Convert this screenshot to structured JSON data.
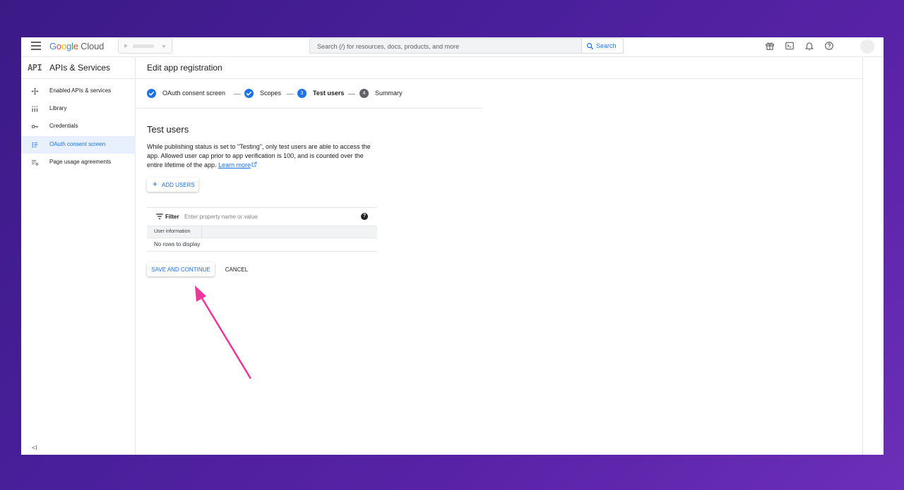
{
  "topbar": {
    "logo_text": "Google Cloud",
    "search_placeholder": "Search (/) for resources, docs, products, and more",
    "search_button": "Search"
  },
  "sidebar": {
    "badge": "API",
    "title": "APIs & Services",
    "items": [
      {
        "label": "Enabled APIs & services",
        "icon": "diamond-dots-icon",
        "active": false
      },
      {
        "label": "Library",
        "icon": "library-grid-icon",
        "active": false
      },
      {
        "label": "Credentials",
        "icon": "key-icon",
        "active": false
      },
      {
        "label": "OAuth consent screen",
        "icon": "consent-dots-icon",
        "active": true
      },
      {
        "label": "Page usage agreements",
        "icon": "settings-list-icon",
        "active": false
      }
    ],
    "collapse_glyph": "<I"
  },
  "main": {
    "title": "Edit app registration",
    "steps": [
      {
        "label": "OAuth consent screen",
        "state": "done"
      },
      {
        "label": "Scopes",
        "state": "done"
      },
      {
        "label": "Test users",
        "state": "current",
        "number": "3"
      },
      {
        "label": "Summary",
        "state": "pending",
        "number": "4"
      }
    ],
    "section_title": "Test users",
    "description": "While publishing status is set to \"Testing\", only test users are able to access the app. Allowed user cap prior to app verification is 100, and is counted over the entire lifetime of the app.",
    "learn_more": "Learn more",
    "add_users": "ADD USERS",
    "filter_label": "Filter",
    "filter_placeholder": "Enter property name or value",
    "table_column": "User information",
    "no_rows": "No rows to display",
    "save_button": "SAVE AND CONTINUE",
    "cancel_button": "CANCEL"
  },
  "colors": {
    "accent": "#1a73e8",
    "annotation_arrow": "#f0359a",
    "background_gradient": "#4a1f9c"
  }
}
